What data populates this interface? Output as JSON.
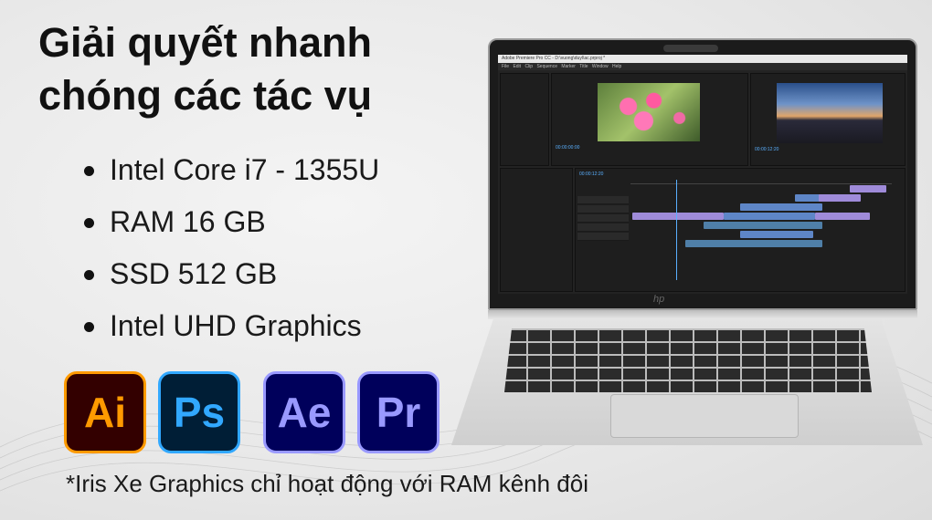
{
  "headline": [
    "Giải quyết nhanh",
    "chóng các tác vụ"
  ],
  "specs": [
    "Intel Core i7 - 1355U",
    "RAM 16 GB",
    "SSD 512 GB",
    "Intel UHD Graphics"
  ],
  "apps": [
    {
      "label": "Ai",
      "icon": "adobe-illustrator-icon",
      "color": "#ff9a00"
    },
    {
      "label": "Ps",
      "icon": "adobe-photoshop-icon",
      "color": "#31a8ff"
    },
    {
      "label": "Ae",
      "icon": "adobe-after-effects-icon",
      "color": "#9999ff"
    },
    {
      "label": "Pr",
      "icon": "adobe-premiere-icon",
      "color": "#9999ff"
    }
  ],
  "footnote": "*Iris Xe Graphics chỉ hoạt động với RAM kênh đôi",
  "laptop": {
    "brand_logo": "hp",
    "screen": {
      "window_title": "Adobe Premiere Pro CC - D:\\vuong\\duyl\\ac.prproj *",
      "menu": "File Edit Clip Sequence Marker Title Window Help",
      "source_timecode": "00:00:00:00",
      "program_timecode": "00:00:12:20",
      "timeline_timecode": "00:00:12:20"
    }
  }
}
